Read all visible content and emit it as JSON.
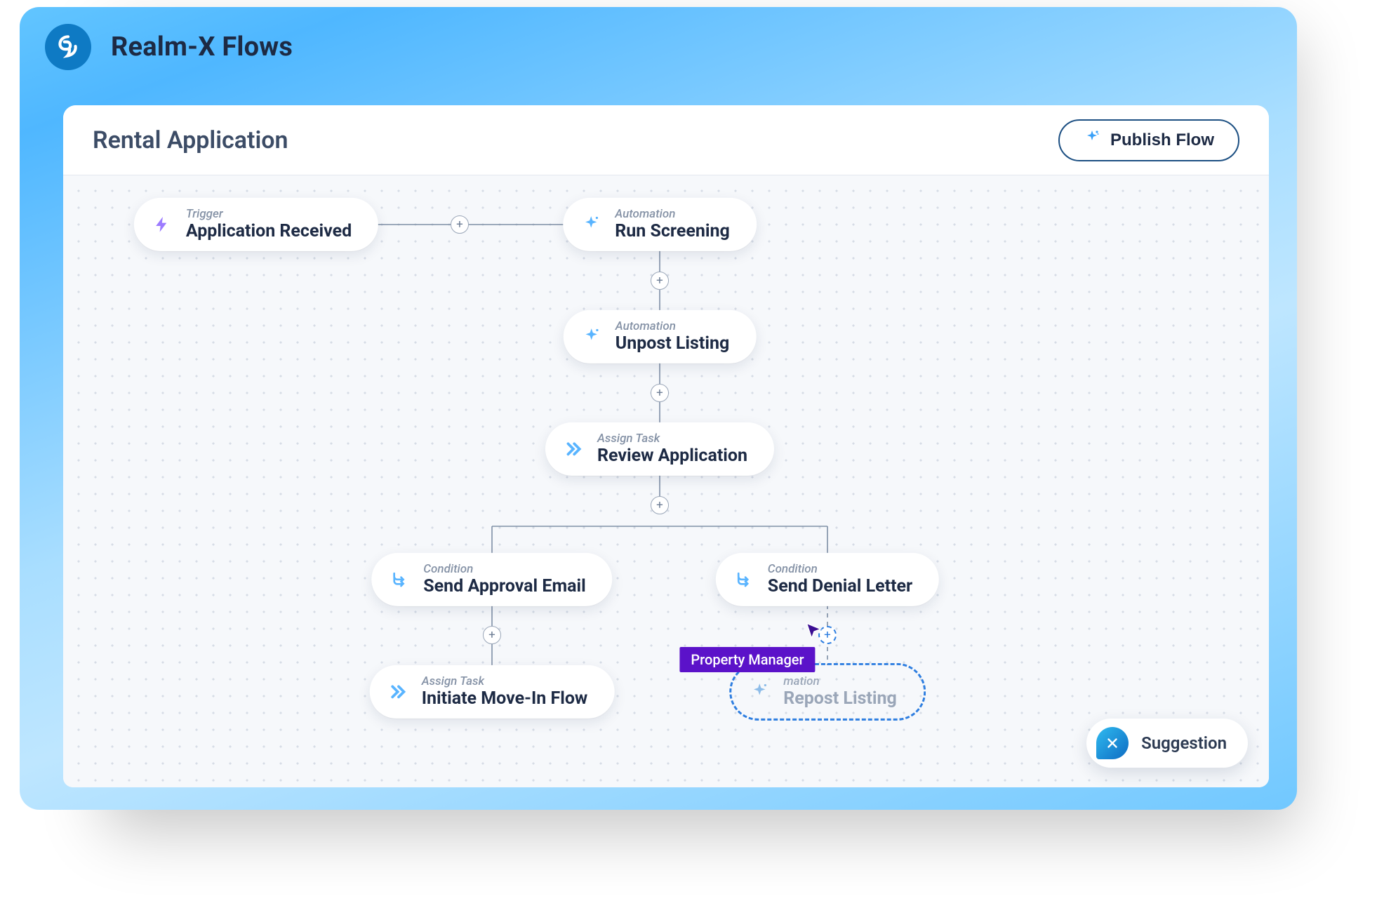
{
  "app": {
    "title": "Realm-X Flows"
  },
  "flow": {
    "title": "Rental Application",
    "publish_label": "Publish Flow"
  },
  "suggestion_chip": {
    "label": "Suggestion"
  },
  "collaborator": {
    "name": "Property Manager"
  },
  "nodes": {
    "trigger": {
      "kind": "Trigger",
      "label": "Application Received"
    },
    "screening": {
      "kind": "Automation",
      "label": "Run Screening"
    },
    "unpost": {
      "kind": "Automation",
      "label": "Unpost Listing"
    },
    "review": {
      "kind": "Assign Task",
      "label": "Review Application"
    },
    "approve": {
      "kind": "Condition",
      "label": "Send Approval Email"
    },
    "deny": {
      "kind": "Condition",
      "label": "Send Denial Letter"
    },
    "movein": {
      "kind": "Assign Task",
      "label": "Initiate Move-In Flow"
    },
    "repost": {
      "kind": "mation",
      "label": "Repost Listing"
    }
  },
  "colors": {
    "accent_blue": "#3AA0F8",
    "frame_blue_light": "#A9DEFF",
    "frame_blue_dark": "#4FB7FF",
    "text_dark": "#1D2A44",
    "text_muted": "#8592A6",
    "edge": "#7F8FA6",
    "collab_purple": "#5B12C9"
  }
}
